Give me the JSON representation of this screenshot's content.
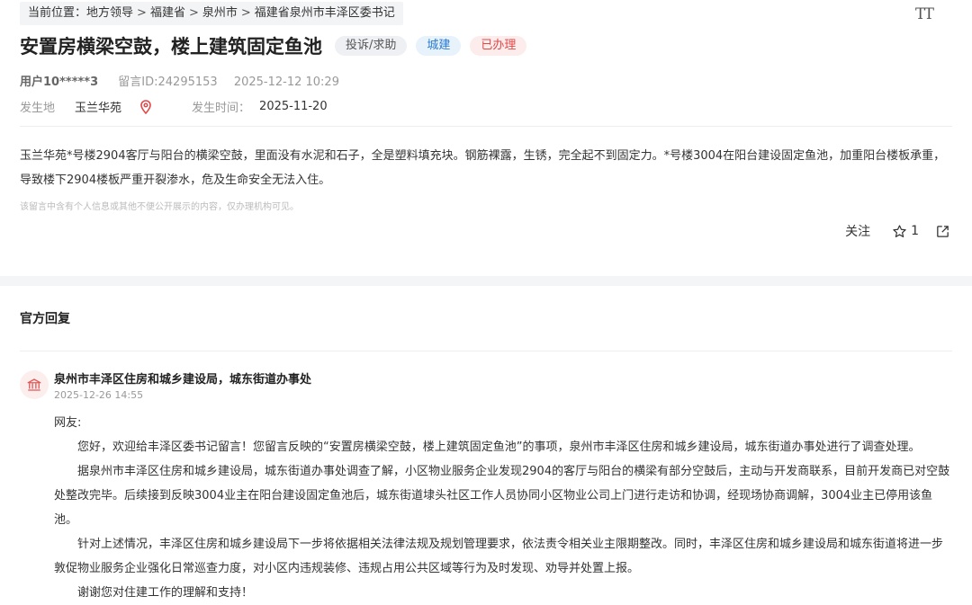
{
  "breadcrumb": {
    "prefix": "当前位置：",
    "items": [
      "地方领导",
      "福建省",
      "泉州市",
      "福建省泉州市丰泽区委书记"
    ]
  },
  "font_toggle_label": "TT",
  "post": {
    "title": "安置房横梁空鼓，楼上建筑固定鱼池",
    "tags": {
      "type": "投诉/求助",
      "category": "城建",
      "status": "已办理"
    },
    "user": "用户10*****3",
    "message_id": "留言ID:24295153",
    "post_time": "2025-12-12 10:29",
    "location_label": "发生地",
    "location": "玉兰华苑",
    "occur_time_label": "发生时间：",
    "occur_time": "2025-11-20",
    "content": "玉兰华苑*号楼2904客厅与阳台的横梁空鼓，里面没有水泥和石子，全是塑料填充块。钢筋裸露，生锈，完全起不到固定力。*号楼3004在阳台建设固定鱼池，加重阳台楼板承重，导致楼下2904楼板严重开裂渗水，危及生命安全无法入住。",
    "privacy_note": "该留言中含有个人信息或其他不便公开展示的内容，仅办理机构可见。",
    "follow_label": "关注",
    "star_count": "1"
  },
  "reply": {
    "section_title": "官方回复",
    "org": "泉州市丰泽区住房和城乡建设局，城东街道办事处",
    "time": "2025-12-26 14:55",
    "greeting": "网友:",
    "paragraphs": [
      "您好，欢迎给丰泽区委书记留言！您留言反映的“安置房横梁空鼓，楼上建筑固定鱼池”的事项，泉州市丰泽区住房和城乡建设局，城东街道办事处进行了调查处理。",
      "据泉州市丰泽区住房和城乡建设局，城东街道办事处调查了解，小区物业服务企业发现2904的客厅与阳台的横梁有部分空鼓后，主动与开发商联系，目前开发商已对空鼓处整改完毕。后续接到反映3004业主在阳台建设固定鱼池后，城东街道埭头社区工作人员协同小区物业公司上门进行走访和协调，经现场协商调解，3004业主已停用该鱼池。",
      "针对上述情况，丰泽区住房和城乡建设局下一步将依据相关法律法规及规划管理要求，依法责令相关业主限期整改。同时，丰泽区住房和城乡建设局和城东街道将进一步敦促物业服务企业强化日常巡查力度，对小区内违规装修、违规占用公共区域等行为及时发现、劝导并处置上报。",
      "谢谢您对住建工作的理解和支持！"
    ]
  },
  "colors": {
    "tag_category": "#2a7bd0",
    "tag_status": "#e04848",
    "pin": "#e04848",
    "org_icon": "#e05a5a"
  },
  "icons": [
    "font-size-icon",
    "location-pin-icon",
    "star-icon",
    "share-icon",
    "government-building-icon"
  ]
}
